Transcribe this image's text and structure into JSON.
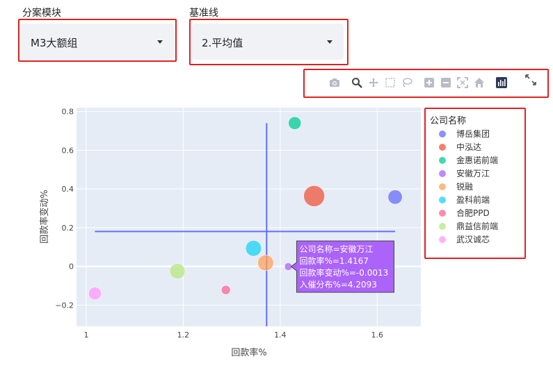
{
  "filters": {
    "module_label": "分案模块",
    "module_value": "M3大额组",
    "baseline_label": "基准线",
    "baseline_value": "2.平均值"
  },
  "toolbar": {
    "icons": [
      "camera-icon",
      "zoom-icon",
      "pan-icon",
      "box-select-icon",
      "lasso-icon",
      "zoom-in-icon",
      "zoom-out-icon",
      "autoscale-icon",
      "home-icon",
      "bar-logo-icon",
      "fullscreen-icon"
    ]
  },
  "legend": {
    "title": "公司名称",
    "position": "right"
  },
  "tooltip": {
    "lines": [
      "公司名称=安徽万江",
      "回款率%=1.4167",
      "回款率变动%=-0.0013",
      "入催分布%=4.2093"
    ],
    "point_index": 3,
    "bg": "#ab63fa"
  },
  "chart_data": {
    "type": "scatter",
    "xlabel": "回款率%",
    "ylabel": "回款率变动%",
    "xlim": [
      0.98,
      1.69
    ],
    "ylim": [
      -0.31,
      0.82
    ],
    "x_ticks": [
      "1",
      "1.2",
      "1.4",
      "1.6"
    ],
    "x_tick_values": [
      1,
      1.2,
      1.4,
      1.6
    ],
    "y_ticks": [
      "0.8",
      "0.6",
      "0.4",
      "0.2",
      "0",
      "−0.2"
    ],
    "y_tick_values": [
      0.8,
      0.6,
      0.4,
      0.2,
      0,
      -0.2
    ],
    "grid": true,
    "series": [
      {
        "name": "博岳集团",
        "x": 1.637,
        "y": 0.358,
        "size": 4.5,
        "color": "#636efa"
      },
      {
        "name": "中泓达",
        "x": 1.47,
        "y": 0.363,
        "size": 7.5,
        "color": "#ef553b"
      },
      {
        "name": "金惠诺前端",
        "x": 1.43,
        "y": 0.74,
        "size": 3.8,
        "color": "#00cc96"
      },
      {
        "name": "安徽万江",
        "x": 1.4167,
        "y": -0.0013,
        "size": 1.5,
        "color": "#ab63fa"
      },
      {
        "name": "锐融",
        "x": 1.37,
        "y": 0.018,
        "size": 5.2,
        "color": "#ffa15a"
      },
      {
        "name": "盈科前端",
        "x": 1.345,
        "y": 0.093,
        "size": 5.2,
        "color": "#19d3f3"
      },
      {
        "name": "合肥PPD",
        "x": 1.288,
        "y": -0.122,
        "size": 2.2,
        "color": "#ff6692"
      },
      {
        "name": "鼎益信前端",
        "x": 1.188,
        "y": -0.025,
        "size": 5.0,
        "color": "#b6e880"
      },
      {
        "name": "武汉诚芯",
        "x": 1.018,
        "y": -0.14,
        "size": 3.8,
        "color": "#ff97ff"
      }
    ],
    "baselines": {
      "vertical_x": 1.372,
      "vertical_y_range": [
        -0.31,
        0.74
      ],
      "horizontal_y": 0.18,
      "horizontal_x_range": [
        1.018,
        1.637
      ],
      "color": "#636efa"
    }
  }
}
